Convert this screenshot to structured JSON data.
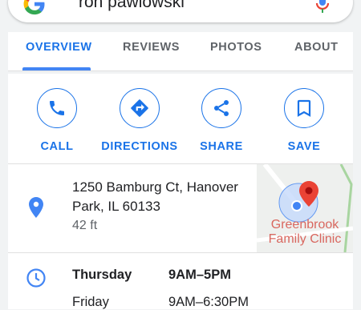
{
  "search": {
    "query": "ron pawlowski"
  },
  "tabs": [
    {
      "label": "OVERVIEW"
    },
    {
      "label": "REVIEWS"
    },
    {
      "label": "PHOTOS"
    },
    {
      "label": "ABOUT"
    }
  ],
  "actions": [
    {
      "label": "CALL",
      "icon": "phone-icon"
    },
    {
      "label": "DIRECTIONS",
      "icon": "directions-icon"
    },
    {
      "label": "SHARE",
      "icon": "share-icon"
    },
    {
      "label": "SAVE",
      "icon": "bookmark-icon"
    }
  ],
  "address": {
    "line1": "1250 Bamburg Ct, Hanover",
    "line2": "Park, IL 60133",
    "distance": "42 ft"
  },
  "map": {
    "label_line1": "Greenbrook",
    "label_line2": "Family Clinic"
  },
  "hours": {
    "day": "Thursday",
    "time": "9AM–5PM",
    "next_day": "Friday",
    "next_time": "9AM–6:30PM"
  },
  "colors": {
    "accent": "#1a73e8",
    "pin": "#4285f4",
    "map_marker": "#ea4335"
  }
}
